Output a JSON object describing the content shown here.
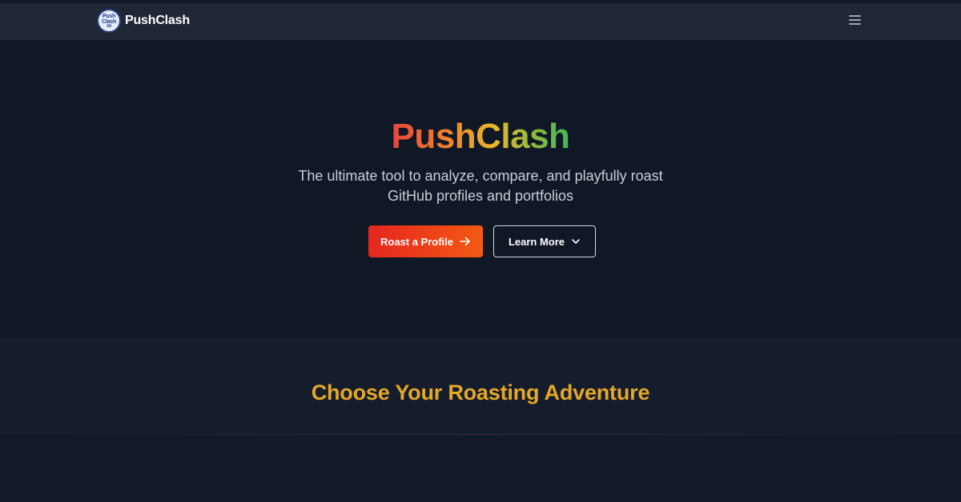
{
  "navbar": {
    "logo_text": [
      "Push",
      "Clash",
      "ЗА"
    ],
    "brand": "PushClash",
    "menu_icon": "hamburger-menu-icon"
  },
  "hero": {
    "title": "PushClash",
    "subtitle_line1": "The ultimate tool to analyze, compare, and playfully roast",
    "subtitle_line2": "GitHub profiles and portfolios",
    "primary_button": "Roast a Profile",
    "primary_icon": "arrow-right-icon",
    "secondary_button": "Learn More",
    "secondary_icon": "chevron-down-icon"
  },
  "section": {
    "title": "Choose Your Roasting Adventure"
  },
  "colors": {
    "background": "#101725",
    "navbar": "#1f2735",
    "primary_button": "#e5261f",
    "section_title": "#e6a824",
    "title_gradient": [
      "#e8453c",
      "#f0802c",
      "#e7b826",
      "#3cba54"
    ]
  }
}
